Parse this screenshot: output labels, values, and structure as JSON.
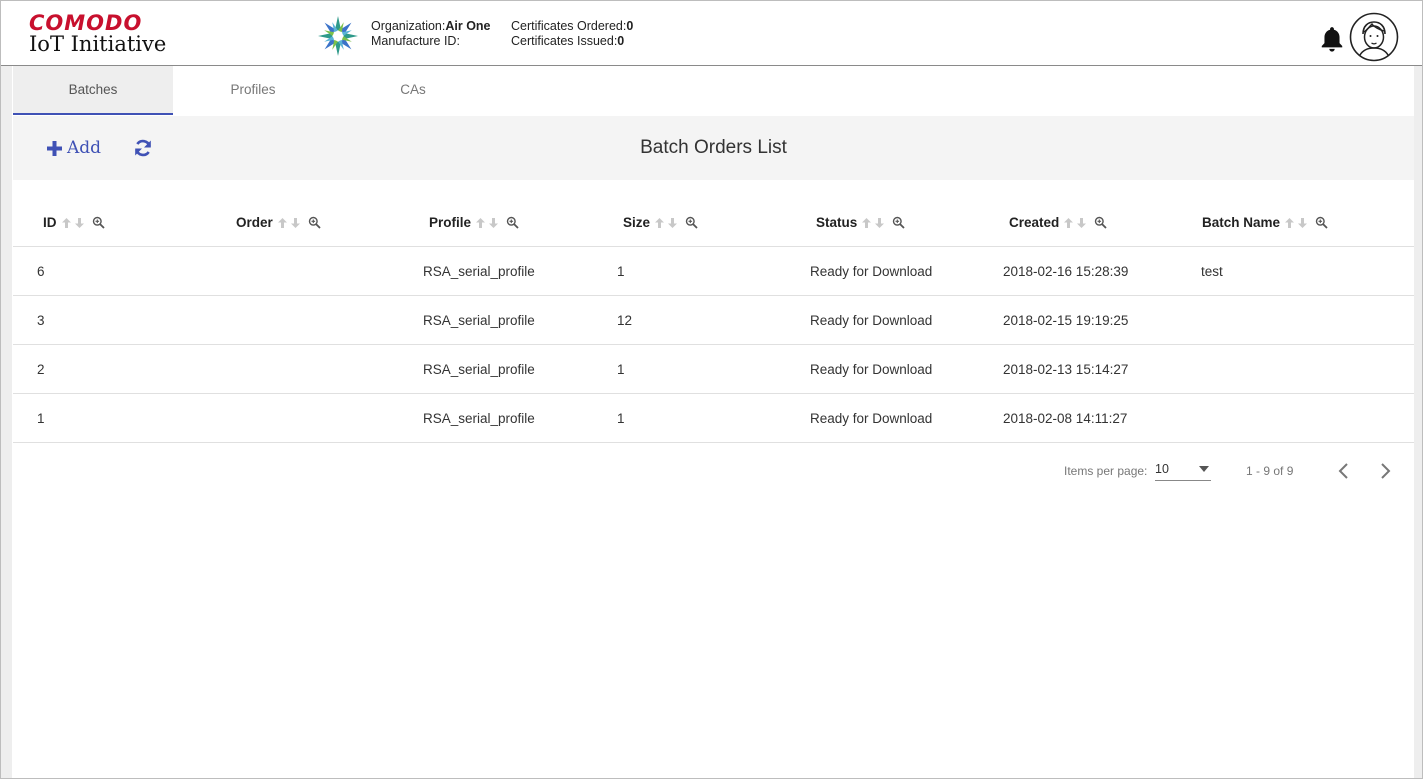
{
  "brand": {
    "name": "COMODO",
    "product": "IoT Initiative"
  },
  "org": {
    "organization_label": "Organization:",
    "organization_value": "Air One",
    "manufacture_label": "Manufacture ID:",
    "manufacture_value": "",
    "ordered_label": "Certificates Ordered:",
    "ordered_value": "0",
    "issued_label": "Certificates Issued:",
    "issued_value": "0"
  },
  "tabs": [
    {
      "label": "Batches",
      "active": true
    },
    {
      "label": "Profiles",
      "active": false
    },
    {
      "label": "CAs",
      "active": false
    }
  ],
  "toolbar": {
    "add_label": "Add",
    "title": "Batch Orders List"
  },
  "table": {
    "columns": [
      "ID",
      "Order",
      "Profile",
      "Size",
      "Status",
      "Created",
      "Batch Name"
    ],
    "rows": [
      [
        "6",
        "",
        "RSA_serial_profile",
        "1",
        "Ready for Download",
        "2018-02-16 15:28:39",
        "test"
      ],
      [
        "3",
        "",
        "RSA_serial_profile",
        "12",
        "Ready for Download",
        "2018-02-15 19:19:25",
        ""
      ],
      [
        "2",
        "",
        "RSA_serial_profile",
        "1",
        "Ready for Download",
        "2018-02-13 15:14:27",
        ""
      ],
      [
        "1",
        "",
        "RSA_serial_profile",
        "1",
        "Ready for Download",
        "2018-02-08 14:11:27",
        ""
      ]
    ]
  },
  "paginator": {
    "items_per_page_label": "Items per page:",
    "items_per_page_value": "10",
    "range_label": "1 - 9 of 9"
  },
  "colors": {
    "brand_red": "#c8102e",
    "accent": "#3f51b5",
    "toolbar_bg": "#f4f4f4",
    "tab_active_bg": "#eeeeee"
  },
  "icons": {
    "org_logo": "starburst-logo-icon",
    "notifications": "bell-icon",
    "user": "avatar-icon",
    "add": "plus-icon",
    "refresh": "refresh-icon",
    "sort_asc": "arrow-up-icon",
    "sort_desc": "arrow-down-icon",
    "filter": "zoom-search-icon",
    "prev": "chevron-left-icon",
    "next": "chevron-right-icon"
  }
}
